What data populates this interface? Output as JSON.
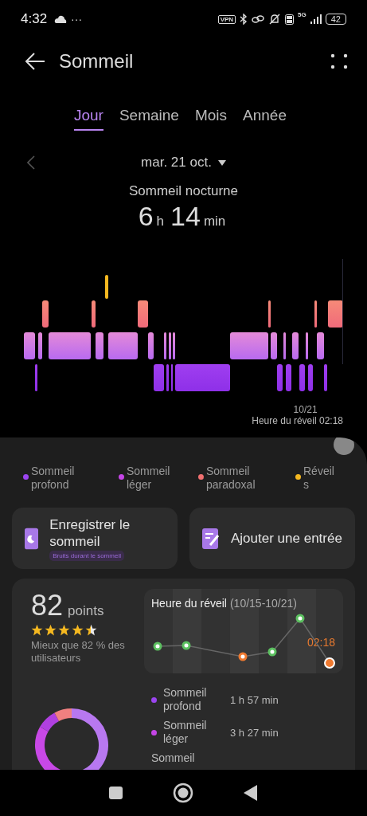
{
  "status_bar": {
    "time": "4:32",
    "more": "···",
    "vpn": "VPN",
    "network": "5G",
    "battery": "42"
  },
  "header": {
    "title": "Sommeil"
  },
  "tabs": [
    {
      "label": "Jour",
      "selected": true
    },
    {
      "label": "Semaine",
      "selected": false
    },
    {
      "label": "Mois",
      "selected": false
    },
    {
      "label": "Année",
      "selected": false
    }
  ],
  "date": {
    "label": "mar. 21 oct."
  },
  "summary": {
    "title": "Sommeil nocturne",
    "hours": "6",
    "hours_unit": "h",
    "minutes": "14",
    "minutes_unit": "min"
  },
  "hypnogram": {
    "date": "10/21",
    "wake_label": "Heure du réveil 02:18"
  },
  "legend": [
    {
      "label": "Sommeil profond",
      "color": "#9b45f0"
    },
    {
      "label": "Sommeil léger",
      "color": "#c545e6"
    },
    {
      "label": "Sommeil paradoxal",
      "color": "#f07070"
    },
    {
      "label": "Réveils",
      "color": "#f5b820"
    }
  ],
  "actions": [
    {
      "kind": "record",
      "label": "Enregistrer le sommeil",
      "badge": "Bruits durant le sommeil"
    },
    {
      "kind": "add",
      "label": "Ajouter une entrée"
    }
  ],
  "score": {
    "value": "82",
    "unit": "points",
    "stars": 4.5,
    "comparison": "Mieux que 82 % des utilisateurs"
  },
  "wake_card": {
    "title": "Heure du réveil",
    "range": "(10/15-10/21)",
    "latest": "02:18"
  },
  "stages": [
    {
      "label": "Sommeil profond",
      "duration": "1 h 57 min",
      "color": "#9b45f0"
    },
    {
      "label": "Sommeil léger",
      "duration": "3 h 27 min",
      "color": "#c545e6"
    },
    {
      "label": "Sommeil"
    }
  ]
}
